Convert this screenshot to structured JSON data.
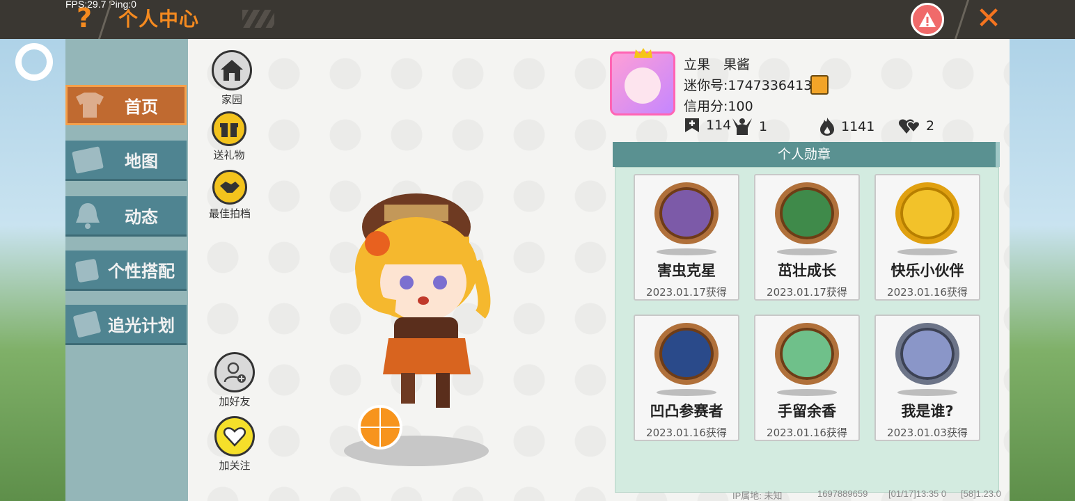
{
  "header": {
    "fps_text": "FPS:29.7  Ping:0",
    "title": "个人中心",
    "help_icon": "question-mark-icon",
    "report_icon": "warning-triangle-icon",
    "close_icon": "close-x-icon"
  },
  "sidebar": {
    "items": [
      {
        "label": "首页",
        "icon": "shirt-icon",
        "active": true
      },
      {
        "label": "地图",
        "icon": "map-picture-icon",
        "active": false
      },
      {
        "label": "动态",
        "icon": "bell-icon",
        "active": false
      },
      {
        "label": "个性搭配",
        "icon": "character-icon",
        "active": false
      },
      {
        "label": "追光计划",
        "icon": "plan-card-icon",
        "active": false
      }
    ]
  },
  "actions": {
    "home": "家园",
    "gift": "送礼物",
    "partner": "最佳拍档",
    "add_friend": "加好友",
    "follow": "加关注"
  },
  "profile": {
    "name": "立果　果酱",
    "mini_id": "迷你号:1747336413",
    "credit": "信用分:100",
    "stats": [
      {
        "icon": "bookmark-plus-icon",
        "value": "114"
      },
      {
        "icon": "cheer-person-icon",
        "value": "1"
      },
      {
        "icon": "flame-icon",
        "value": "1141"
      },
      {
        "icon": "hearts-icon",
        "value": "2"
      }
    ]
  },
  "medals": {
    "title": "个人勋章",
    "items": [
      {
        "name": "害虫克星",
        "date": "2023.01.17获得",
        "color": "#7c5aa8"
      },
      {
        "name": "茁壮成长",
        "date": "2023.01.17获得",
        "color": "#3f8a4a"
      },
      {
        "name": "快乐小伙伴",
        "date": "2023.01.16获得",
        "color": "#f2c22a"
      },
      {
        "name": "凹凸参赛者",
        "date": "2023.01.16获得",
        "color": "#2a4a8a"
      },
      {
        "name": "手留余香",
        "date": "2023.01.16获得",
        "color": "#6fc08a"
      },
      {
        "name": "我是谁?",
        "date": "2023.01.03获得",
        "color": "#8a96c8"
      }
    ]
  },
  "footer": {
    "ip": "IP属地: 未知",
    "code": "1697889659",
    "time": "[01/17]13:35 0",
    "version": "[58]1.23.0"
  }
}
